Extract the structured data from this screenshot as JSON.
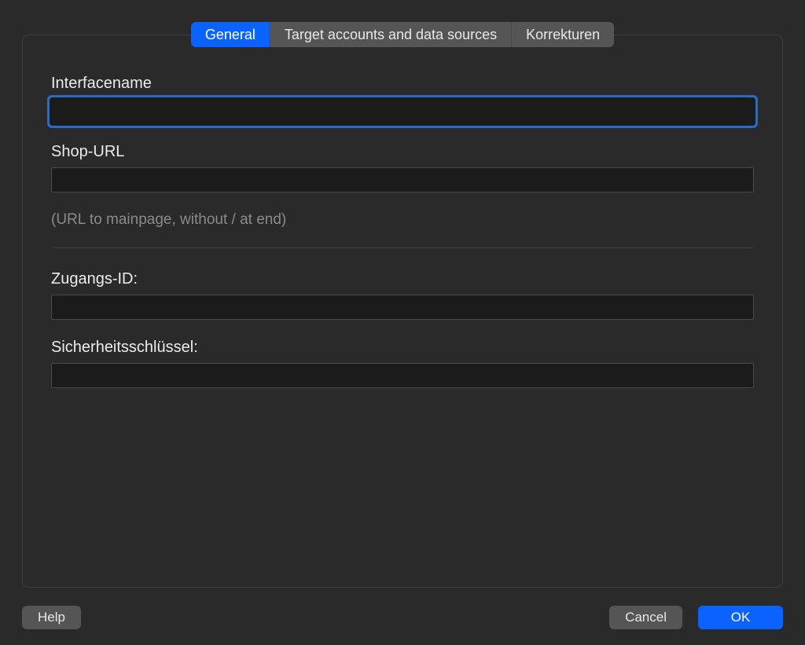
{
  "tabs": {
    "general": "General",
    "target": "Target accounts and data sources",
    "korrekturen": "Korrekturen"
  },
  "fields": {
    "interfacename": {
      "label": "Interfacename",
      "value": ""
    },
    "shopurl": {
      "label": "Shop-URL",
      "value": "",
      "help": "(URL to mainpage, without / at end)"
    },
    "zugangsid": {
      "label": "Zugangs-ID:",
      "value": ""
    },
    "sicherheitsschluessel": {
      "label": "Sicherheitsschlüssel:",
      "value": ""
    }
  },
  "buttons": {
    "help": "Help",
    "cancel": "Cancel",
    "ok": "OK"
  }
}
